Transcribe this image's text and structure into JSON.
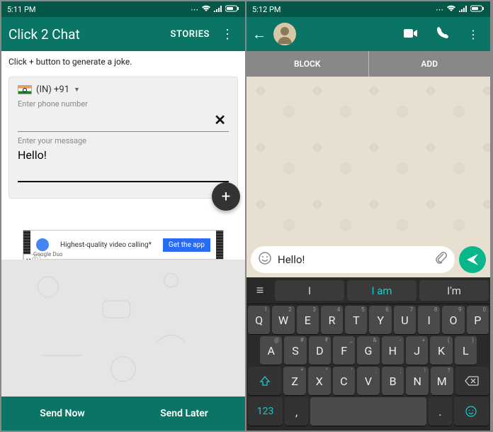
{
  "left": {
    "time": "5:11 PM",
    "title": "Click 2 Chat",
    "menu_stories": "STORIES",
    "hint": "Click + button to generate a joke.",
    "country_code": "(IN)  +91",
    "phone_label": "Enter phone number",
    "msg_label": "Enter your message",
    "msg_value": "Hello!",
    "ad_brand": "Google Duo",
    "ad_text": "Highest-quality video calling*",
    "ad_cta": "Get the app",
    "send_now": "Send Now",
    "send_later": "Send Later"
  },
  "right": {
    "time": "5:12 PM",
    "block": "BLOCK",
    "add": "ADD",
    "compose_value": "Hello!",
    "suggest": {
      "a": "I",
      "b": "I am",
      "c": "I'm"
    },
    "kb": {
      "row1": [
        {
          "m": "Q",
          "s": "1"
        },
        {
          "m": "W",
          "s": "2"
        },
        {
          "m": "E",
          "s": "3"
        },
        {
          "m": "R",
          "s": "4"
        },
        {
          "m": "T",
          "s": "5"
        },
        {
          "m": "Y",
          "s": "6"
        },
        {
          "m": "U",
          "s": "7"
        },
        {
          "m": "I",
          "s": "8"
        },
        {
          "m": "O",
          "s": "9"
        },
        {
          "m": "P",
          "s": "0"
        }
      ],
      "row2": [
        {
          "m": "A",
          "s": "@"
        },
        {
          "m": "S",
          "s": "#"
        },
        {
          "m": "D",
          "s": "₹"
        },
        {
          "m": "F",
          "s": "_"
        },
        {
          "m": "G",
          "s": "&"
        },
        {
          "m": "H",
          "s": "-"
        },
        {
          "m": "J",
          "s": "+"
        },
        {
          "m": "K",
          "s": "("
        },
        {
          "m": "L",
          "s": ")"
        }
      ],
      "row3": [
        {
          "m": "Z",
          "s": "*"
        },
        {
          "m": "X",
          "s": "\""
        },
        {
          "m": "C",
          "s": "'"
        },
        {
          "m": "V",
          "s": ":"
        },
        {
          "m": "B",
          "s": ";"
        },
        {
          "m": "N",
          "s": "!"
        },
        {
          "m": "M",
          "s": "?"
        }
      ],
      "numkey": "123",
      "comma": ",",
      "period": "."
    }
  }
}
